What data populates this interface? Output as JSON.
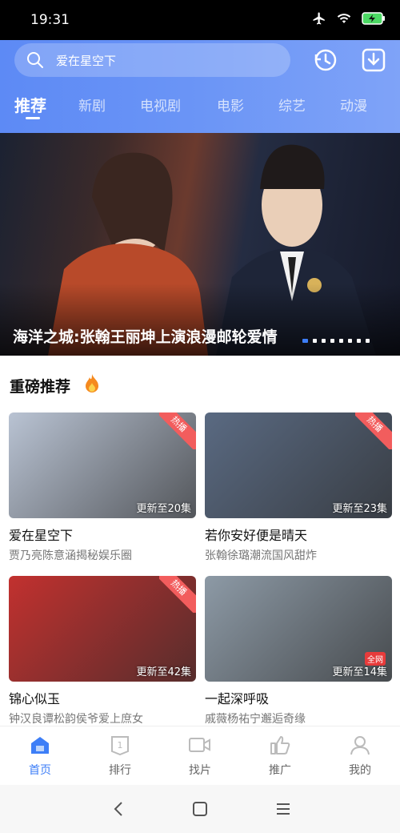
{
  "status": {
    "time": "19:31"
  },
  "search": {
    "placeholder": "爱在星空下"
  },
  "tabs": [
    "推荐",
    "新剧",
    "电视剧",
    "电影",
    "综艺",
    "动漫"
  ],
  "banner": {
    "title": "海洋之城:张翰王丽坤上演浪漫邮轮爱情",
    "slide_count": 8,
    "active_slide": 1
  },
  "section": {
    "title": "重磅推荐"
  },
  "cards": [
    {
      "title": "爱在星空下",
      "subtitle": "贾乃亮陈意涵揭秘娱乐圈",
      "update": "更新至20集",
      "badge": "热播",
      "color": "#b9c3d3"
    },
    {
      "title": "若你安好便是晴天",
      "subtitle": "张翰徐璐潮流国风甜炸",
      "update": "更新至23集",
      "badge": "热播",
      "color": "#5a6a82"
    },
    {
      "title": "锦心似玉",
      "subtitle": "钟汉良谭松韵侯爷爱上庶女",
      "update": "更新至42集",
      "badge": "热播",
      "color": "#c2312f"
    },
    {
      "title": "一起深呼吸",
      "subtitle": "戚薇杨祐宁邂逅奇缘",
      "update": "更新至14集",
      "badge_quanwang": "全网",
      "color": "#8d9aa6"
    }
  ],
  "nav": [
    {
      "label": "首页",
      "icon": "home-icon",
      "active": true
    },
    {
      "label": "排行",
      "icon": "ranking-icon"
    },
    {
      "label": "找片",
      "icon": "video-camera-icon"
    },
    {
      "label": "推广",
      "icon": "thumbs-up-icon"
    },
    {
      "label": "我的",
      "icon": "user-icon"
    }
  ],
  "colors": {
    "accent": "#3d7ef7",
    "header_start": "#5d8af5",
    "hot_badge": "#f25d5d"
  }
}
